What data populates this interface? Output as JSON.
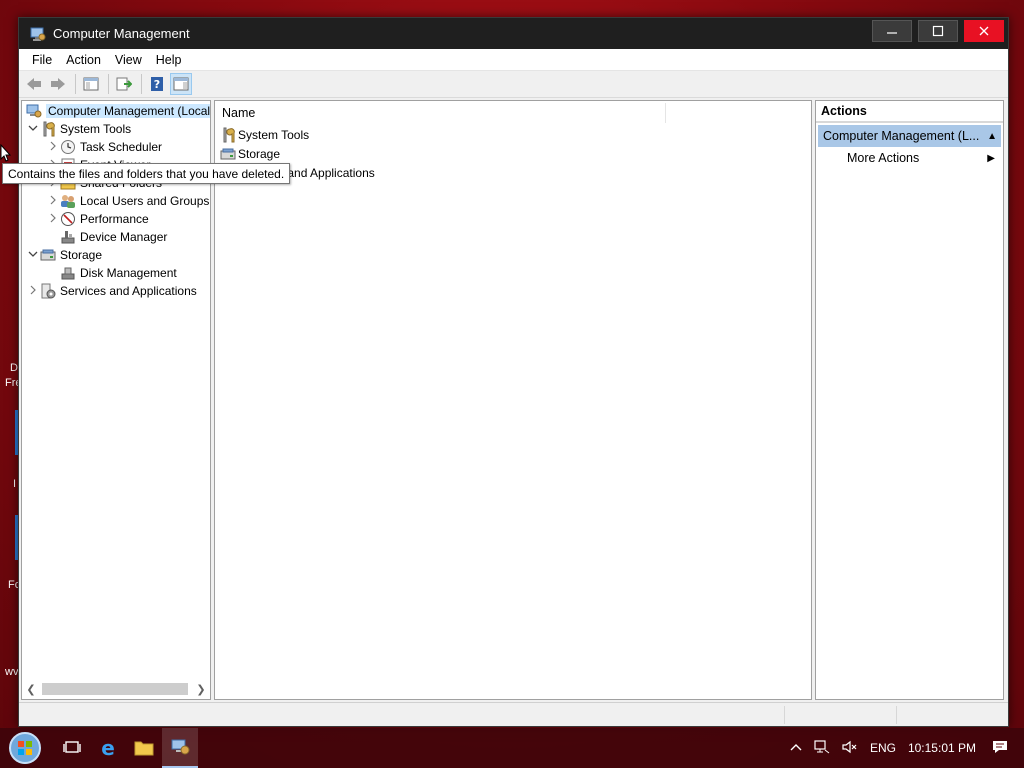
{
  "window": {
    "title": "Computer Management"
  },
  "menu": [
    "File",
    "Action",
    "View",
    "Help"
  ],
  "tree": {
    "root": "Computer Management (Local",
    "system_tools": "System Tools",
    "task_scheduler": "Task Scheduler",
    "event_viewer": "Event Viewer",
    "shared_folders": "Shared Folders",
    "local_users": "Local Users and Groups",
    "performance": "Performance",
    "device_manager": "Device Manager",
    "storage": "Storage",
    "disk_management": "Disk Management",
    "services": "Services and Applications"
  },
  "main": {
    "column_name": "Name",
    "items": [
      "System Tools",
      "Storage",
      "Services and Applications"
    ]
  },
  "actions": {
    "title": "Actions",
    "section": "Computer Management (L...",
    "more_actions": "More Actions"
  },
  "tooltip": "Contains the files and folders that you have deleted.",
  "taskbar": {
    "language": "ENG",
    "time": "10:15:01 PM"
  },
  "desktop_fragments": [
    "D",
    "Fre",
    "I",
    "Fc",
    "wv"
  ]
}
